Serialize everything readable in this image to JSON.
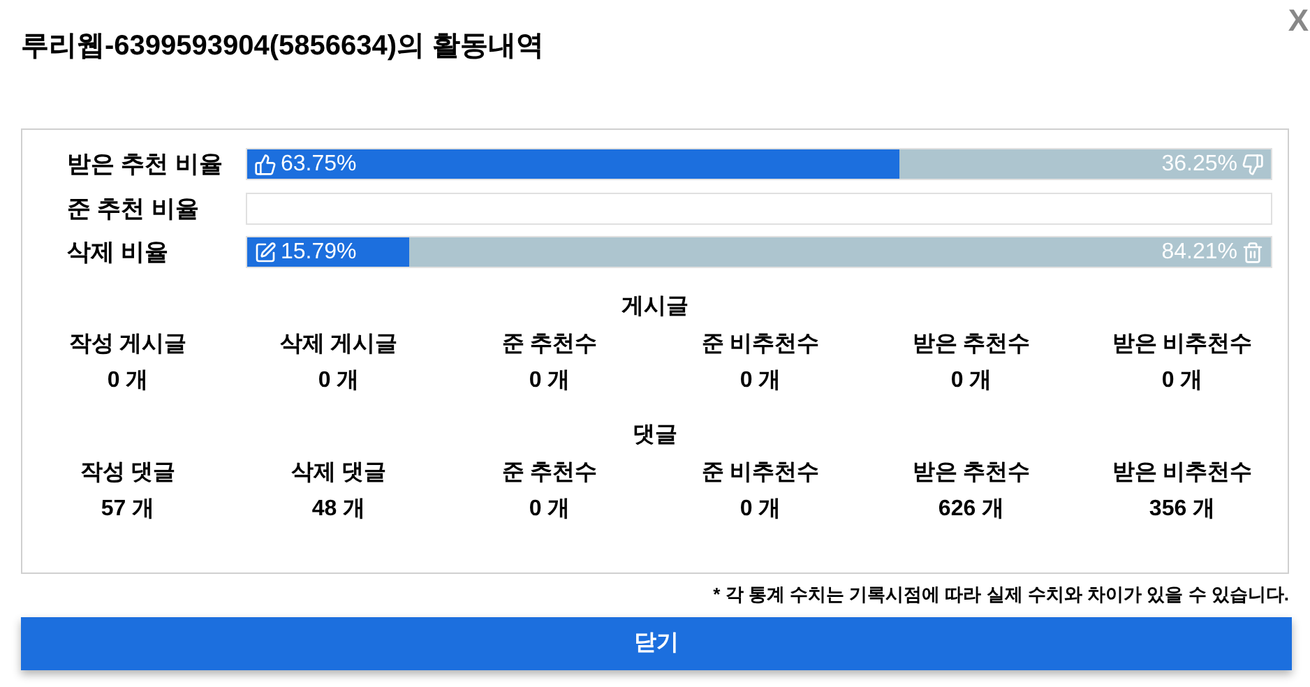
{
  "close_label": "X",
  "title": "루리웹-6399593904(5856634)의 활동내역",
  "ratios": [
    {
      "label": "받은 추천 비율",
      "kind": "vote",
      "level": 0.6375,
      "left_text": "63.75%",
      "right_text": "36.25%"
    },
    {
      "label": "준 추천 비율",
      "kind": "empty"
    },
    {
      "label": "삭제 비율",
      "kind": "delete",
      "level": 0.1579,
      "left_text": "15.79%",
      "right_text": "84.21%"
    }
  ],
  "sections": [
    {
      "title": "게시글",
      "stats": [
        {
          "label": "작성 게시글",
          "value": "0 개"
        },
        {
          "label": "삭제 게시글",
          "value": "0 개"
        },
        {
          "label": "준 추천수",
          "value": "0 개"
        },
        {
          "label": "준 비추천수",
          "value": "0 개"
        },
        {
          "label": "받은 추천수",
          "value": "0 개"
        },
        {
          "label": "받은 비추천수",
          "value": "0 개"
        }
      ]
    },
    {
      "title": "댓글",
      "stats": [
        {
          "label": "작성 댓글",
          "value": "57 개"
        },
        {
          "label": "삭제 댓글",
          "value": "48 개"
        },
        {
          "label": "준 추천수",
          "value": "0 개"
        },
        {
          "label": "준 비추천수",
          "value": "0 개"
        },
        {
          "label": "받은 추천수",
          "value": "626 개"
        },
        {
          "label": "받은 비추천수",
          "value": "356 개"
        }
      ]
    }
  ],
  "note": "* 각 통계 수치는 기록시점에 따라 실제 수치와 차이가 있을 수 있습니다.",
  "close_button": "닫기"
}
